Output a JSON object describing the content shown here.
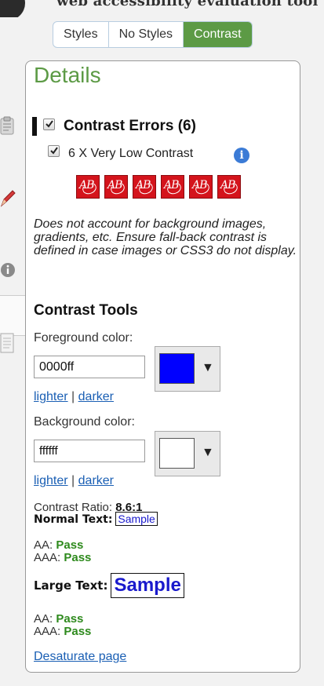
{
  "header": {
    "title": "web accessibility evaluation tool"
  },
  "view_tabs": [
    {
      "label": "Styles",
      "active": false
    },
    {
      "label": "No Styles",
      "active": false
    },
    {
      "label": "Contrast",
      "active": true
    }
  ],
  "panel": {
    "title": "Details",
    "errors": {
      "heading": "Contrast Errors (6)",
      "checked": true,
      "item_label": "6 X Very Low Contrast",
      "item_checked": true,
      "icon_glyph": "ⓘ",
      "error_icon_text": "AB",
      "error_icon_count": 6
    },
    "note": "Does not account for background images, gradients, etc. Ensure fall-back contrast is defined in case images or CSS3 do not display.",
    "tools": {
      "heading": "Contrast Tools",
      "foreground": {
        "label": "Foreground color:",
        "value": "0000ff",
        "swatch_color": "#0000ff",
        "lighter": "lighter",
        "separator": "|",
        "darker": "darker"
      },
      "background": {
        "label": "Background color:",
        "value": "ffffff",
        "swatch_color": "#ffffff",
        "lighter": "lighter",
        "separator": "|",
        "darker": "darker"
      },
      "ratio_label": "Contrast Ratio:",
      "ratio_value": "8.6:1",
      "normal": {
        "label": "Normal Text:",
        "sample": "Sample",
        "aa_label": "AA:",
        "aa_value": "Pass",
        "aaa_label": "AAA:",
        "aaa_value": "Pass"
      },
      "large": {
        "label": "Large Text:",
        "sample": "Sample",
        "aa_label": "AA:",
        "aa_value": "Pass",
        "aaa_label": "AAA:",
        "aaa_value": "Pass"
      }
    },
    "desaturate": "Desaturate page"
  },
  "colors": {
    "accent_green": "#5c9a45",
    "pass_green": "#2e8a1d",
    "error_red": "#d4141c",
    "link_blue": "#1a5fb4"
  }
}
